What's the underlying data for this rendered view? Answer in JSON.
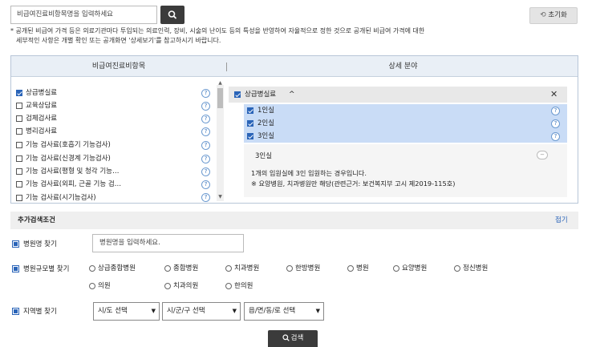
{
  "top": {
    "search_placeholder": "비급여진료비항목명을 입력하세요",
    "reset_label": "초기화",
    "notice_line1": "* 공개된 비급여 가격 등은 의료기관마다 투입되는 의료인력, 장비, 시술의 난이도 등의 특성을 반영하여 자율적으로 정한 것으로 공개된 비급여 가격에 대한",
    "notice_line2": "세부적인 사항은 개별 확인 또는 공개화면 '상세보기'를 참고하시기 바랍니다."
  },
  "panel": {
    "left_header": "비급여진료비항목",
    "right_header": "상세 분야",
    "items": [
      {
        "label": "상급병실료",
        "checked": true
      },
      {
        "label": "교육상담료",
        "checked": false
      },
      {
        "label": "검체검사료",
        "checked": false
      },
      {
        "label": "병리검사료",
        "checked": false
      },
      {
        "label": "기능 검사료(호흡기 기능검사)",
        "checked": false
      },
      {
        "label": "기능 검사료(신경계 기능검사)",
        "checked": false
      },
      {
        "label": "기능 검사료(평형 및 청각 기능…",
        "checked": false
      },
      {
        "label": "기능 검사료(외피, 근골 기능 검…",
        "checked": false
      },
      {
        "label": "기능 검사료(시기능검사)",
        "checked": false
      }
    ],
    "help_glyph": "?",
    "detail": {
      "group_label": "상급병실료",
      "caret": "^",
      "close": "✕",
      "rows": [
        {
          "label": "1인실",
          "checked": true
        },
        {
          "label": "2인실",
          "checked": true
        },
        {
          "label": "3인실",
          "checked": true
        }
      ],
      "info_title": "3인실",
      "info_minus": "−",
      "info_line1": "1개의 입원실에 3인 입원하는 경우입니다.",
      "info_line2": "※ 요양병원, 치과병원만 해당(관련근거: 보건복지부 고시 제2019-115호)"
    }
  },
  "extra": {
    "title": "추가검색조건",
    "toggle": "접기",
    "hospital_name_label": "병원명 찾기",
    "hospital_name_placeholder": "병원명을 입력하세요.",
    "scale_label": "병원규모별 찾기",
    "scale_options_row1": [
      "상급종합병원",
      "종합병원",
      "치과병원",
      "한방병원",
      "병원",
      "요양병원",
      "정신병원"
    ],
    "scale_options_row2": [
      "의원",
      "치과의원",
      "한의원"
    ],
    "region_label": "지역별 찾기",
    "region_selects": [
      "시/도 선택",
      "시/군/구 선택",
      "읍/면/동/로 선택"
    ],
    "search_button": "검색"
  },
  "icons": {
    "search": "search-icon",
    "reset": "refresh-icon",
    "accent": "#2a64b8",
    "header_bg": "#e9eff6",
    "selected_bg": "#c9dcf6"
  }
}
